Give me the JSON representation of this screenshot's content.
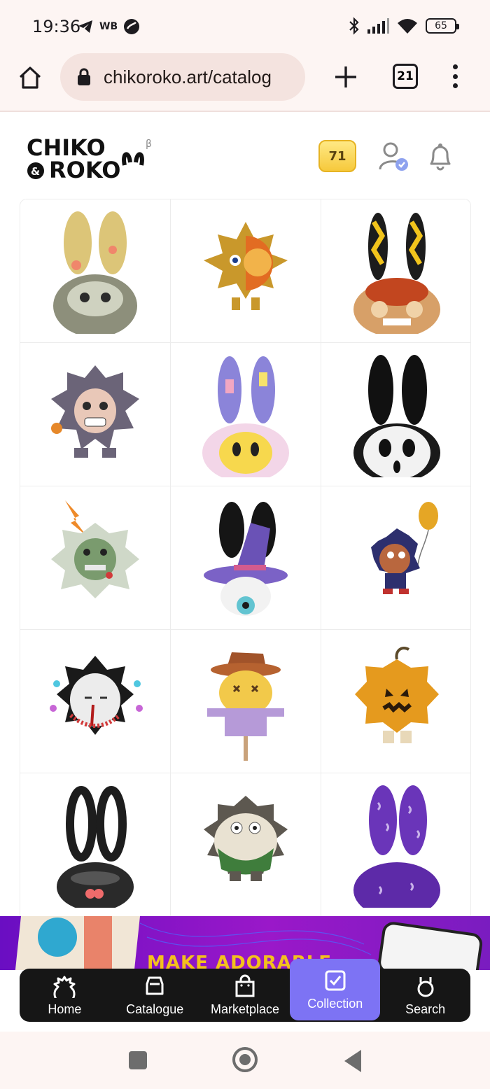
{
  "status_bar": {
    "time": "19:36",
    "carrier_tag": "WB",
    "battery": "65",
    "icons": [
      "telegram-icon",
      "sync-icon",
      "bluetooth-icon",
      "signal-icon",
      "wifi-icon",
      "battery-icon"
    ]
  },
  "browser": {
    "url": "chikoroko.art/catalog",
    "tab_count": "21",
    "icons": [
      "home-icon",
      "lock-icon",
      "plus-icon",
      "tabs-icon",
      "more-vert-icon"
    ]
  },
  "header": {
    "logo_text": "CHIKO & ROKO",
    "beta_mark": "β",
    "coin_count": "71",
    "icons": [
      "coin-badge",
      "verified-user-icon",
      "bell-icon"
    ]
  },
  "catalog": {
    "items": [
      "wheat-flower-bunny-toy",
      "golden-sun-half-skull-toy",
      "yellow-ear-ornate-mask-bunny-toy",
      "purple-cat-hood-toy",
      "pastel-smiley-bunny-toy",
      "ghostface-bunny-toy",
      "lightning-zombie-toy",
      "witch-hat-bunny-toy",
      "balloon-kid-toy",
      "bloody-tear-white-toy",
      "scarecrow-toy",
      "pumpkin-jack-toy",
      "black-bunny-red-heart-toy",
      "owl-hedgehog-toy",
      "purple-pattern-bunny-toy"
    ]
  },
  "promo": {
    "text": "MAKE ADORABLE"
  },
  "bottom_nav": {
    "items": [
      {
        "label": "Home",
        "icon": "home-hedgehog-icon",
        "active": false
      },
      {
        "label": "Catalogue",
        "icon": "catalogue-icon",
        "active": false
      },
      {
        "label": "Marketplace",
        "icon": "shopping-bag-icon",
        "active": false
      },
      {
        "label": "Collection",
        "icon": "collection-check-icon",
        "active": true
      },
      {
        "label": "Search",
        "icon": "search-bunny-icon",
        "active": false
      }
    ]
  },
  "colors": {
    "accent": "#7d73f4",
    "nav_bg": "#161616",
    "coin_gold": "#f6c93c",
    "browser_bg": "#fdf5f3"
  }
}
